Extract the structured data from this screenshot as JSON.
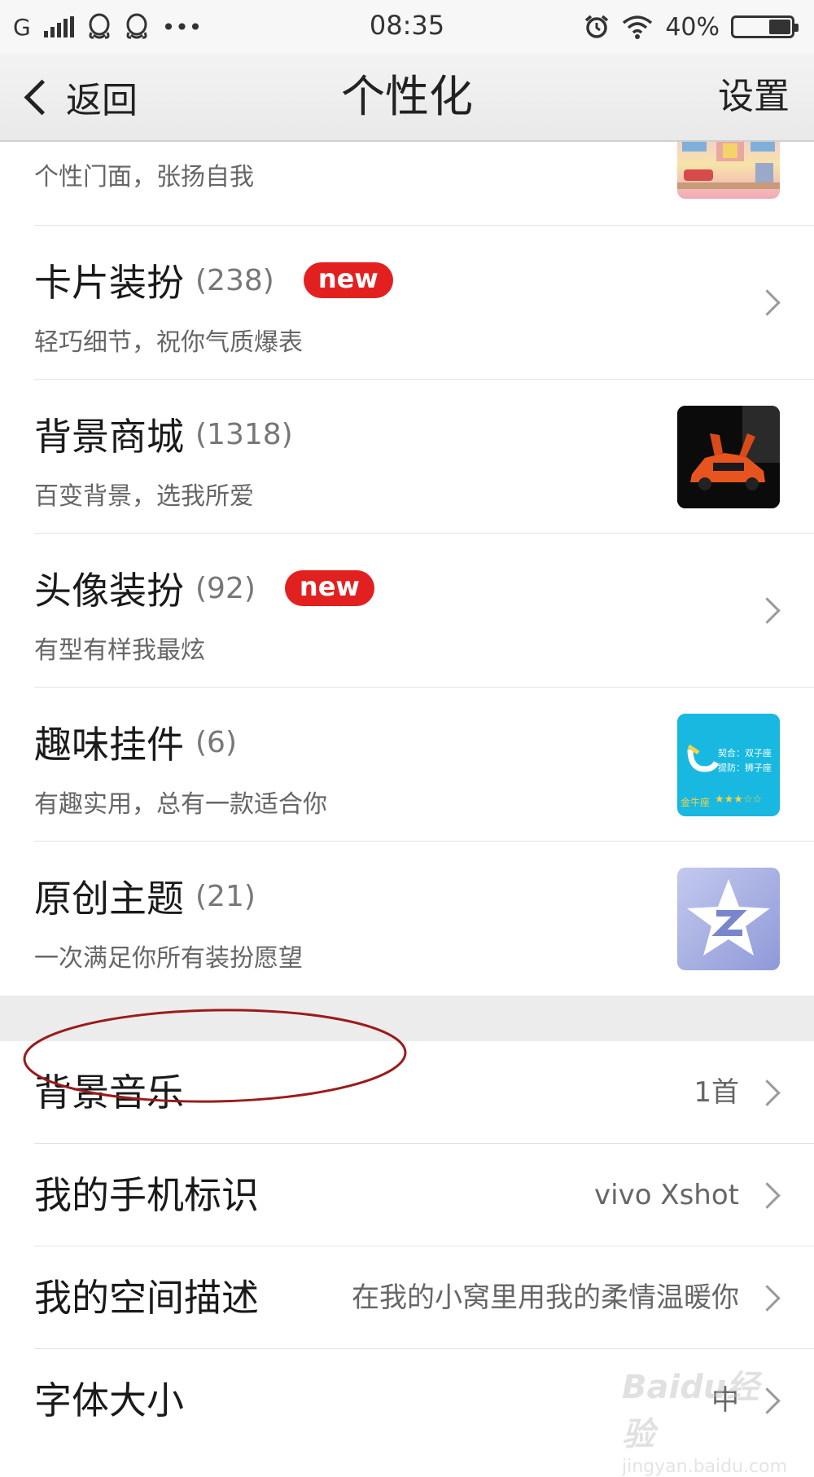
{
  "status_bar": {
    "carrier": "G",
    "dots": "•••",
    "time": "08:35",
    "battery_percent": "40%",
    "battery_level": 0.4
  },
  "nav": {
    "back_label": "返回",
    "title": "个性化",
    "settings_label": "设置"
  },
  "items": [
    {
      "title": "",
      "count": "",
      "subtitle": "个性门面，张扬自我",
      "badge": "",
      "thumb": "shop"
    },
    {
      "title": "卡片装扮",
      "count": "(238)",
      "subtitle": "轻巧细节，祝你气质爆表",
      "badge": "new",
      "thumb": ""
    },
    {
      "title": "背景商城",
      "count": "(1318)",
      "subtitle": "百变背景，选我所爱",
      "badge": "",
      "thumb": "car"
    },
    {
      "title": "头像装扮",
      "count": "(92)",
      "subtitle": "有型有样我最炫",
      "badge": "new",
      "thumb": ""
    },
    {
      "title": "趣味挂件",
      "count": "(6)",
      "subtitle": "有趣实用，总有一款适合你",
      "badge": "",
      "thumb": "widget"
    },
    {
      "title": "原创主题",
      "count": "(21)",
      "subtitle": "一次满足你所有装扮愿望",
      "badge": "",
      "thumb": "theme"
    }
  ],
  "widget_thumb": {
    "line1": "契合：双子座",
    "line2": "提防：狮子座",
    "label": "金牛座",
    "stars": "★★★☆☆"
  },
  "settings": [
    {
      "label": "背景音乐",
      "value": "1首"
    },
    {
      "label": "我的手机标识",
      "value": "vivo Xshot"
    },
    {
      "label": "我的空间描述",
      "value": "在我的小窝里用我的柔情温暖你"
    },
    {
      "label": "字体大小",
      "value": "中"
    }
  ],
  "watermark": {
    "logo": "Baidu经验",
    "url": "jingyan.baidu.com"
  },
  "colors": {
    "badge": "#e32020",
    "annotation": "#9b1b1b",
    "widget_bg": "#18b8e0"
  },
  "icons": [
    "qq-icon",
    "alarm-icon",
    "wifi-icon",
    "battery-icon",
    "back-chevron-icon",
    "chevron-right-icon"
  ]
}
